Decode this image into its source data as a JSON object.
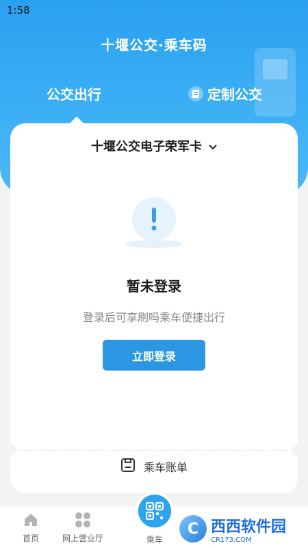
{
  "status_bar": {
    "time": "1:58"
  },
  "header": {
    "title": "十堰公交·乘车码",
    "tab_bus": "公交出行",
    "tab_custom": "定制公交"
  },
  "card": {
    "card_name": "十堰公交电子荣军卡",
    "login_title": "暂未登录",
    "login_subtitle": "登录后可享刷吗乘车便捷出行",
    "login_button": "立即登录",
    "bill_label": "乘车账单"
  },
  "tabbar": {
    "items": [
      {
        "label": "首页",
        "icon": "home-icon"
      },
      {
        "label": "网上营业厅",
        "icon": "grid-icon"
      },
      {
        "label": "乘车",
        "icon": "qr-code-icon"
      }
    ]
  },
  "watermark": {
    "brand": "西西软件园",
    "url": "CR173.COM"
  },
  "colors": {
    "primary": "#2b97e3",
    "header_gradient_top": "#2aa0f0",
    "page_bg": "#f2f3f5"
  }
}
